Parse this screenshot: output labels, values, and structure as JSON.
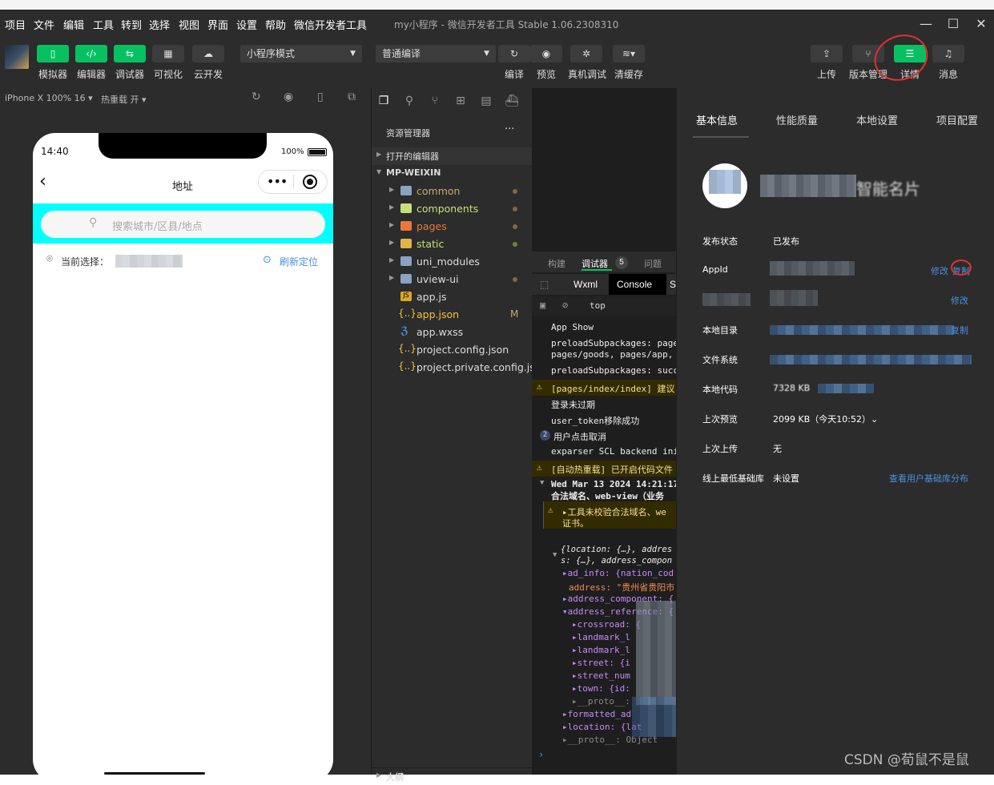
{
  "menu": [
    "项目",
    "文件",
    "编辑",
    "工具",
    "转到",
    "选择",
    "视图",
    "界面",
    "设置",
    "帮助",
    "微信开发者工具"
  ],
  "window_title": "my小程序 - 微信开发者工具 Stable 1.06.2308310",
  "toolbar": {
    "left_buttons": [
      "模拟器",
      "编辑器",
      "调试器",
      "可视化",
      "云开发"
    ],
    "mode_select": "小程序模式",
    "compile_select": "普通编译",
    "mid_buttons": [
      "编译",
      "预览",
      "真机调试",
      "清缓存"
    ],
    "right_buttons": [
      "上传",
      "版本管理",
      "详情",
      "消息"
    ]
  },
  "simulator": {
    "device": "iPhone X 100% 16",
    "hot_reload": "热重载 开",
    "time": "14:40",
    "battery": "100%",
    "page_title": "地址",
    "search_placeholder": "搜索城市/区县/地点",
    "current_label": "当前选择：",
    "relocate": "刷新定位"
  },
  "explorer": {
    "header": "资源管理器",
    "open_editors": "打开的编辑器",
    "project": "MP-WEIXIN",
    "items": [
      {
        "name": "common",
        "type": "folder",
        "color": "#c9a86a"
      },
      {
        "name": "components",
        "type": "folder",
        "color": "#c5e07b"
      },
      {
        "name": "pages",
        "type": "folder",
        "color": "#e8793a"
      },
      {
        "name": "static",
        "type": "folder",
        "color": "#c5e07b"
      },
      {
        "name": "uni_modules",
        "type": "folder",
        "color": "#ddd"
      },
      {
        "name": "uview-ui",
        "type": "folder",
        "color": "#ddd"
      },
      {
        "name": "app.js",
        "type": "js",
        "color": "#ddd"
      },
      {
        "name": "app.json",
        "type": "json",
        "color": "#f5c33b",
        "badge": "M"
      },
      {
        "name": "app.wxss",
        "type": "wxss",
        "color": "#ddd"
      },
      {
        "name": "project.config.json",
        "type": "json",
        "color": "#ddd"
      },
      {
        "name": "project.private.config.js...",
        "type": "json",
        "color": "#ddd"
      }
    ],
    "outline": "大纲"
  },
  "debugger": {
    "tabs": [
      "构建",
      "调试器",
      "问题"
    ],
    "badge": "5",
    "subtabs": [
      "Wxml",
      "Console",
      "S"
    ],
    "context": "top",
    "lines": [
      "App Show",
      "preloadSubpackages: page",
      "pages/goods, pages/app,",
      "preloadSubpackages: succ",
      "[pages/index/index] 建议",
      "登录未过期",
      "user_token移除成功",
      "用户点击取消",
      "exparser SCL backend ini",
      "[自动热重载] 已开启代码文件",
      "Wed Mar 13 2024 14:21:17",
      "合法域名、web-view（业务",
      "▸工具未校验合法域名、we",
      "证书。",
      "{location: {…}, addres",
      "s: {…}, address_compon",
      "▸ad_info: {nation_cod",
      "address: \"贵州省贵阳市",
      "▸address_component: {",
      "▾address_reference: {",
      "▸crossroad: {",
      "▸landmark_l",
      "▸landmark_l",
      "▸street: {i",
      "▸street_num",
      "▸town: {id:",
      "▸__proto__:",
      "▸formatted_ad",
      "▸location: {lat",
      "▸__proto__: Object"
    ],
    "group_count": "2"
  },
  "detail": {
    "tabs": [
      "基本信息",
      "性能质量",
      "本地设置",
      "项目配置"
    ],
    "app_name_suffix": "智能名片",
    "rows": [
      {
        "label": "发布状态",
        "value": "已发布"
      },
      {
        "label": "AppId",
        "value": "",
        "links": [
          "修改",
          "复制"
        ]
      },
      {
        "label": "",
        "value": "",
        "links": [
          "修改"
        ]
      },
      {
        "label": "本地目录",
        "value": "",
        "links": [
          "复制"
        ]
      },
      {
        "label": "文件系统",
        "value": ""
      },
      {
        "label": "本地代码",
        "value": "7328 KB"
      },
      {
        "label": "上次预览",
        "value": "2099 KB（今天10:52）⌄"
      },
      {
        "label": "上次上传",
        "value": "无"
      },
      {
        "label": "线上最低基础库",
        "value": "未设置",
        "links": [
          "查看用户基础库分布"
        ]
      }
    ]
  },
  "watermark": "CSDN @荀鼠不是鼠"
}
